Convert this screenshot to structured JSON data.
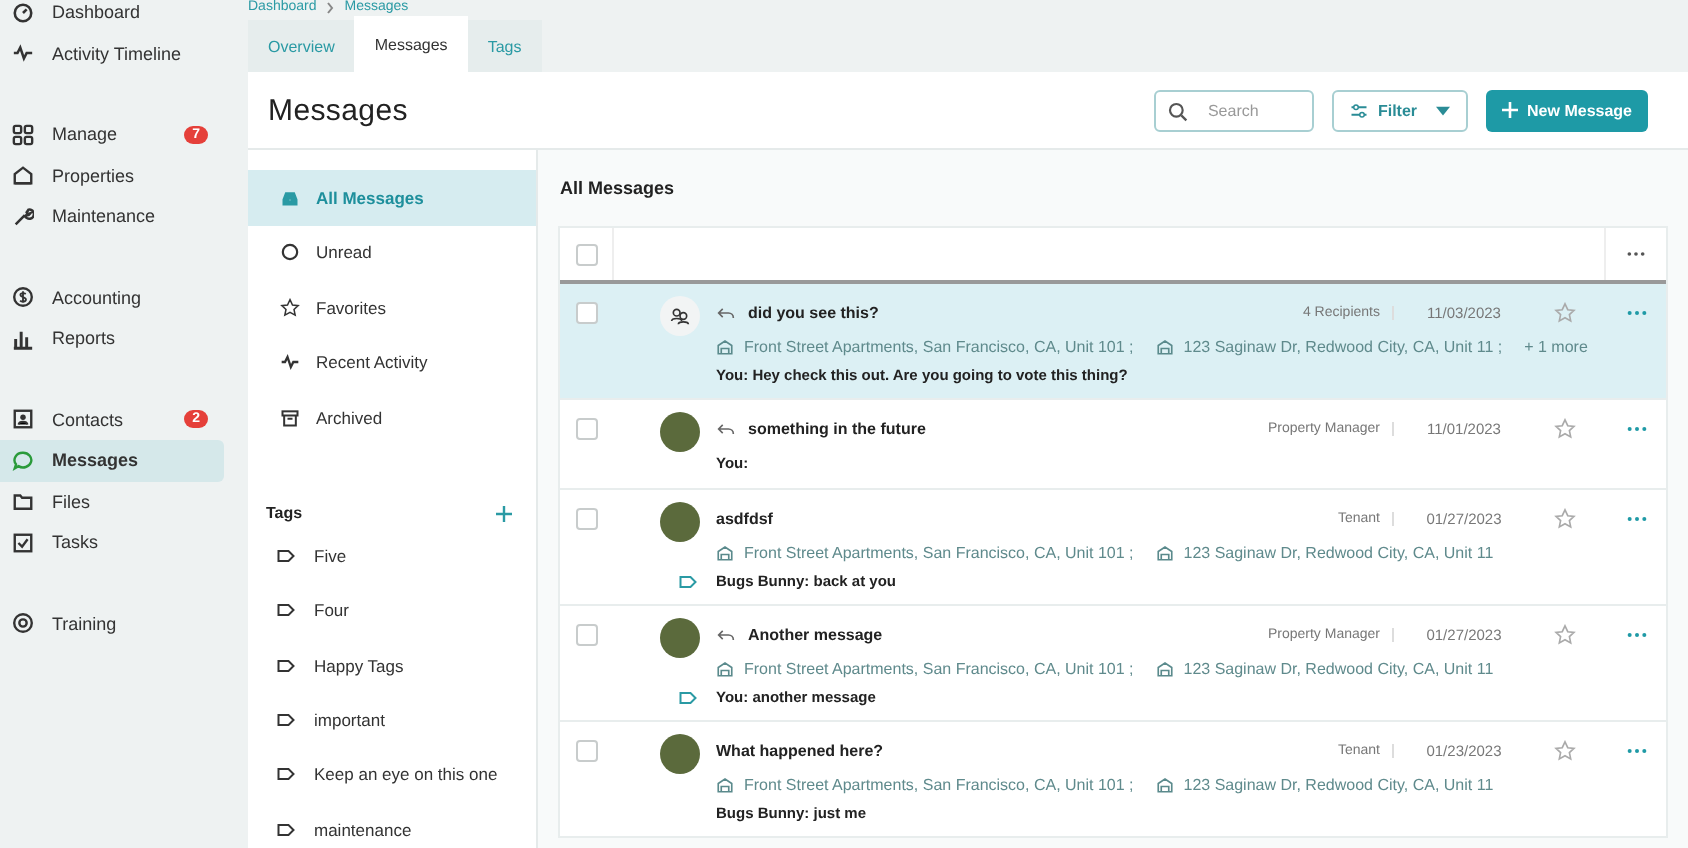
{
  "nav": {
    "groups": [
      [
        {
          "label": "Dashboard",
          "selected": false
        },
        {
          "label": "Activity Timeline",
          "selected": false
        }
      ],
      [
        {
          "label": "Manage",
          "selected": false,
          "badge": "7"
        },
        {
          "label": "Properties",
          "selected": false
        },
        {
          "label": "Maintenance",
          "selected": false
        }
      ],
      [
        {
          "label": "Accounting",
          "selected": false
        },
        {
          "label": "Reports",
          "selected": false
        }
      ],
      [
        {
          "label": "Contacts",
          "selected": false,
          "badge": "2"
        },
        {
          "label": "Messages",
          "selected": true
        },
        {
          "label": "Files",
          "selected": false
        },
        {
          "label": "Tasks",
          "selected": false
        }
      ],
      [
        {
          "label": "Training",
          "selected": false
        }
      ]
    ]
  },
  "breadcrumb": [
    "Dashboard",
    "Messages"
  ],
  "tabs": [
    {
      "label": "Overview",
      "selected": false
    },
    {
      "label": "Messages",
      "selected": true
    },
    {
      "label": "Tags",
      "selected": false
    }
  ],
  "header": {
    "title": "Messages",
    "search": {
      "placeholder": "Search"
    },
    "filter": "Filter",
    "new_button": "New Message"
  },
  "folders": [
    {
      "label": "All Messages",
      "selected": true
    },
    {
      "label": "Unread",
      "selected": false
    },
    {
      "label": "Favorites",
      "selected": false
    },
    {
      "label": "Recent Activity",
      "selected": false
    },
    {
      "label": "Archived",
      "selected": false
    }
  ],
  "tags": {
    "heading": "Tags",
    "items": [
      "Five",
      "Four",
      "Happy Tags",
      "important",
      "Keep an eye on this one",
      "maintenance"
    ]
  },
  "list": {
    "title": "All Messages",
    "select_all_checked": false,
    "rows": [
      {
        "selected": true,
        "checked": false,
        "kind": "group",
        "replied": true,
        "subject": "did you see this?",
        "addresses": [
          "Front Street Apartments, San Francisco, CA, Unit 101 ;",
          "123 Saginaw Dr, Redwood City, CA, Unit 11 ;"
        ],
        "more": "+ 1 more",
        "who": "4 Recipients",
        "date": "11/03/2023",
        "tagged": false,
        "preview": "You: Hey check this out. Are you going to vote this thing?"
      },
      {
        "selected": false,
        "checked": false,
        "kind": "photo",
        "replied": true,
        "subject": "something in the future",
        "addresses": [],
        "who": "Property Manager",
        "date": "11/01/2023",
        "tagged": false,
        "preview": "You:"
      },
      {
        "selected": false,
        "checked": false,
        "kind": "photo",
        "replied": false,
        "subject": "asdfdsf",
        "addresses": [
          "Front Street Apartments, San Francisco, CA, Unit 101 ;",
          "123 Saginaw Dr, Redwood City, CA, Unit 11"
        ],
        "who": "Tenant",
        "date": "01/27/2023",
        "tagged": true,
        "preview": "Bugs Bunny: back at you"
      },
      {
        "selected": false,
        "checked": false,
        "kind": "photo",
        "replied": true,
        "subject": "Another message",
        "addresses": [
          "Front Street Apartments, San Francisco, CA, Unit 101 ;",
          "123 Saginaw Dr, Redwood City, CA, Unit 11"
        ],
        "who": "Property Manager",
        "date": "01/27/2023",
        "tagged": true,
        "preview": "You: another message"
      },
      {
        "selected": false,
        "checked": false,
        "kind": "photo",
        "replied": false,
        "subject": "What happened here?",
        "addresses": [
          "Front Street Apartments, San Francisco, CA, Unit 101 ;",
          "123 Saginaw Dr, Redwood City, CA, Unit 11"
        ],
        "who": "Tenant",
        "date": "01/23/2023",
        "tagged": false,
        "preview": "Bugs Bunny: just me"
      }
    ]
  }
}
